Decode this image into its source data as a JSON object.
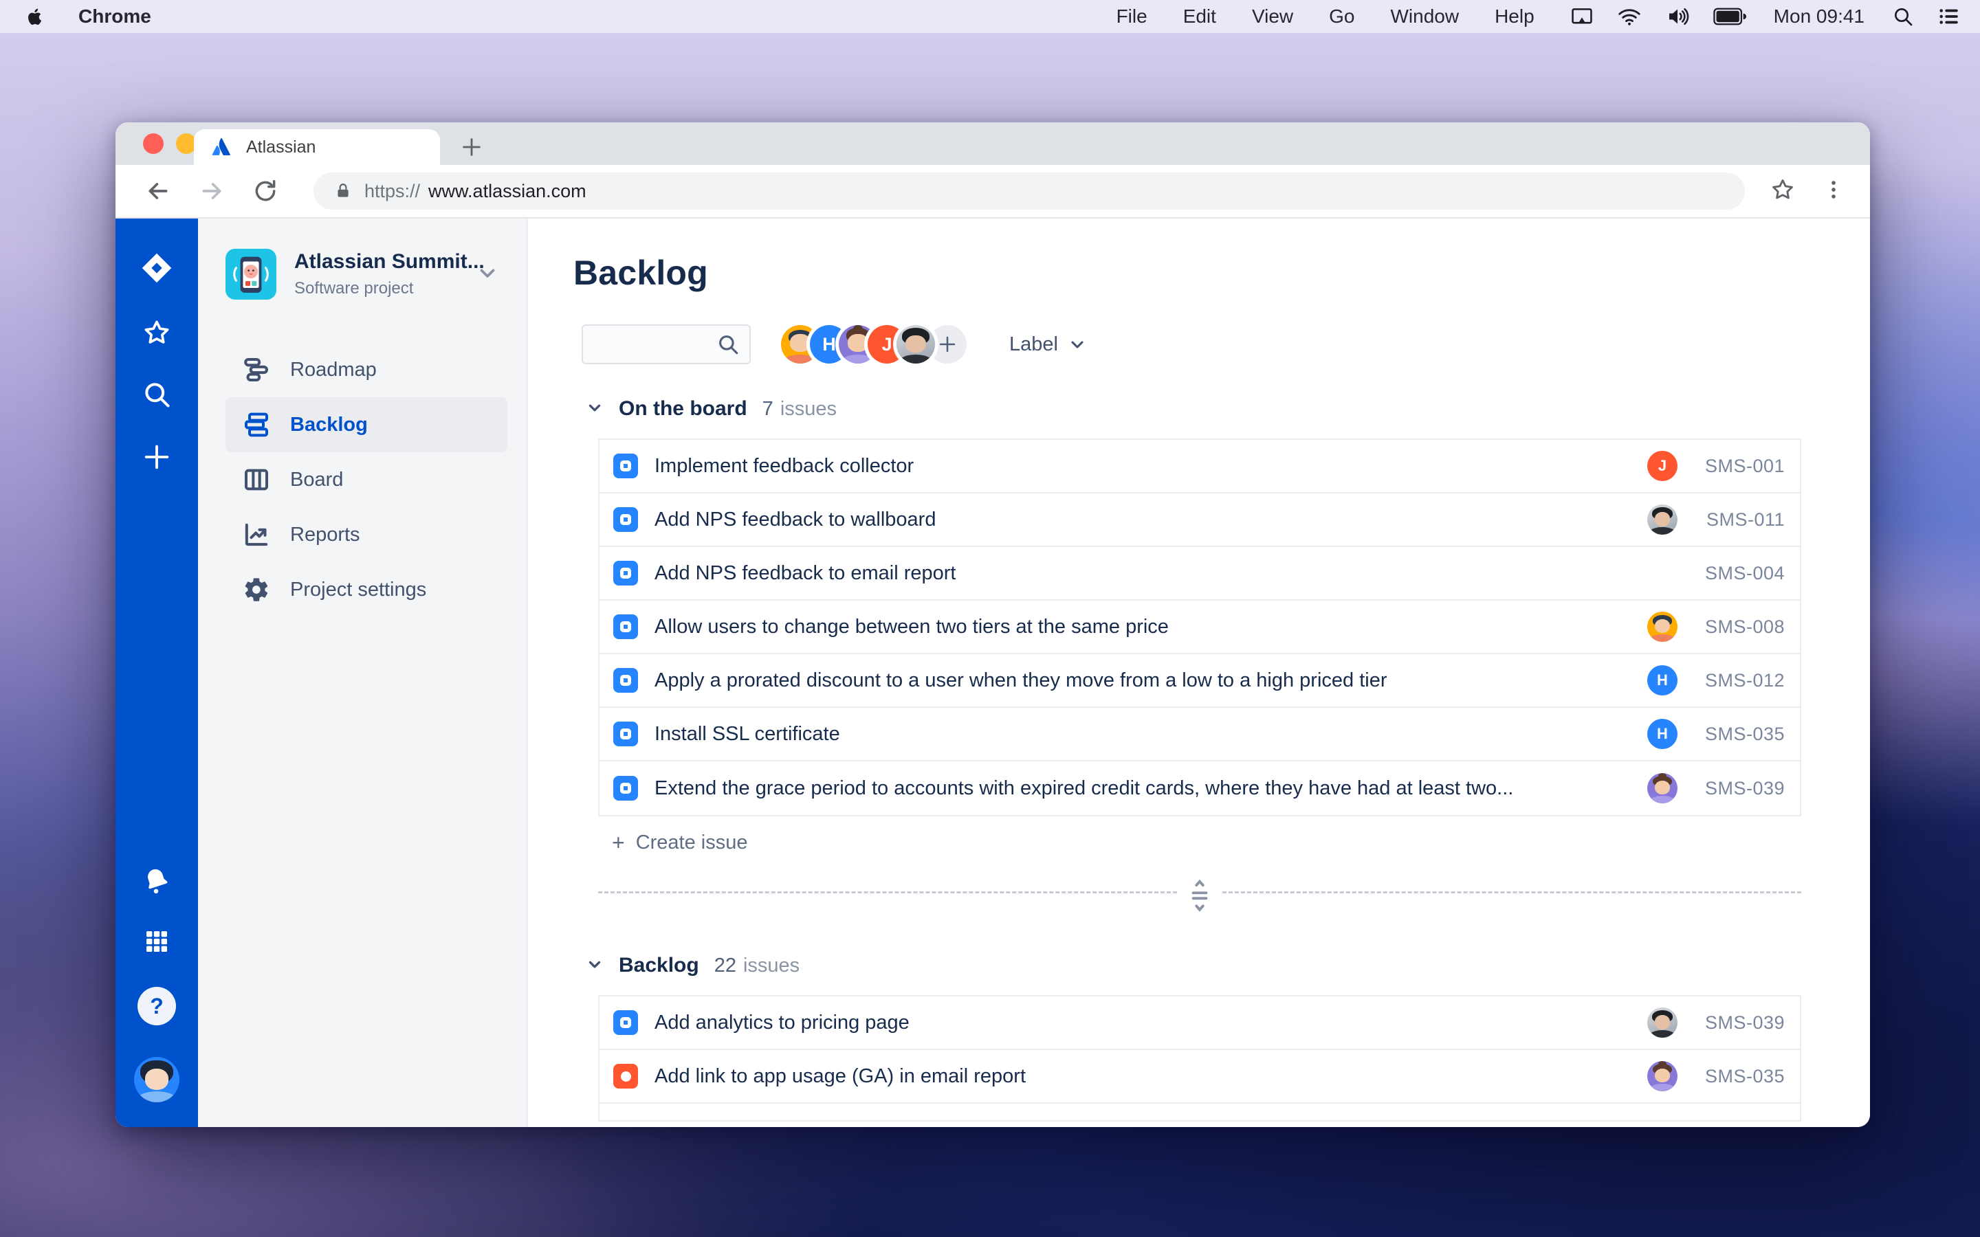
{
  "colors": {
    "accent_blue": "#0052CC",
    "story_icon_blue": "#2684FF",
    "bug_icon_red": "#FF5630",
    "avatar_red": "#FF5630",
    "avatar_blue": "#2684FF",
    "avatar_orange": "#FFAB00",
    "avatar_purple": "#8777D9",
    "text_dark": "#172B4D",
    "text_gray": "#6B778C",
    "sidebar_bg": "#F4F5F7",
    "selected_nav_bg": "#EBECF0"
  },
  "menubar": {
    "items": [
      "Chrome",
      "File",
      "Edit",
      "View",
      "Go",
      "Window",
      "Help"
    ],
    "status_icons": [
      "display-icon",
      "wifi-icon",
      "volume-icon",
      "battery-icon",
      "spotlight-icon",
      "menu-list-icon"
    ],
    "clock": "Mon 09:41"
  },
  "browser": {
    "tab_title": "Atlassian",
    "url_scheme": "https://",
    "url_host": "www.atlassian.com"
  },
  "sidebar_project": {
    "name": "Atlassian Summit...",
    "type": "Software project",
    "items": [
      {
        "label": "Roadmap"
      },
      {
        "label": "Backlog"
      },
      {
        "label": "Board"
      },
      {
        "label": "Reports"
      },
      {
        "label": "Project settings"
      }
    ]
  },
  "main": {
    "title": "Backlog",
    "search_value": "",
    "board_avatars": [
      {
        "kind": "illustration",
        "name": "orange-man-avatar"
      },
      {
        "kind": "letter",
        "letter": "H",
        "color": "#2684FF"
      },
      {
        "kind": "illustration",
        "name": "purple-woman-avatar"
      },
      {
        "kind": "letter",
        "letter": "J",
        "color": "#FF5630"
      },
      {
        "kind": "photo",
        "name": "photo-man-avatar"
      }
    ],
    "label_dropdown": "Label",
    "create_issue_label": "Create issue",
    "create_issue_plus": "+",
    "sections": [
      {
        "title": "On the board",
        "count": "7",
        "unit": "issues",
        "issues": [
          {
            "type": "story",
            "title": "Implement feedback collector",
            "key": "SMS-001",
            "assignee_kind": "letter",
            "assignee_letter": "J",
            "assignee_color": "#FF5630"
          },
          {
            "type": "story",
            "title": "Add NPS feedback to wallboard",
            "key": "SMS-011",
            "assignee_kind": "photo"
          },
          {
            "type": "story",
            "title": "Add NPS feedback to email report",
            "key": "SMS-004",
            "assignee_kind": "none"
          },
          {
            "type": "story",
            "title": "Allow users to change between two tiers at the same price",
            "key": "SMS-008",
            "assignee_kind": "illustration-orange"
          },
          {
            "type": "story",
            "title": "Apply a prorated discount to a user when they move from a low to a high priced tier",
            "key": "SMS-012",
            "assignee_kind": "letter",
            "assignee_letter": "H",
            "assignee_color": "#2684FF"
          },
          {
            "type": "story",
            "title": "Install SSL certificate",
            "key": "SMS-035",
            "assignee_kind": "letter",
            "assignee_letter": "H",
            "assignee_color": "#2684FF"
          },
          {
            "type": "story",
            "title": "Extend the grace period to accounts with expired credit cards, where they have had at least two...",
            "key": "SMS-039",
            "assignee_kind": "illustration-purple"
          }
        ]
      },
      {
        "title": "Backlog",
        "count": "22",
        "unit": "issues",
        "issues": [
          {
            "type": "story",
            "title": "Add analytics to pricing page",
            "key": "SMS-039",
            "assignee_kind": "photo"
          },
          {
            "type": "bug",
            "title": "Add link to app usage (GA) in email report",
            "key": "SMS-035",
            "assignee_kind": "illustration-purple"
          }
        ]
      }
    ]
  }
}
